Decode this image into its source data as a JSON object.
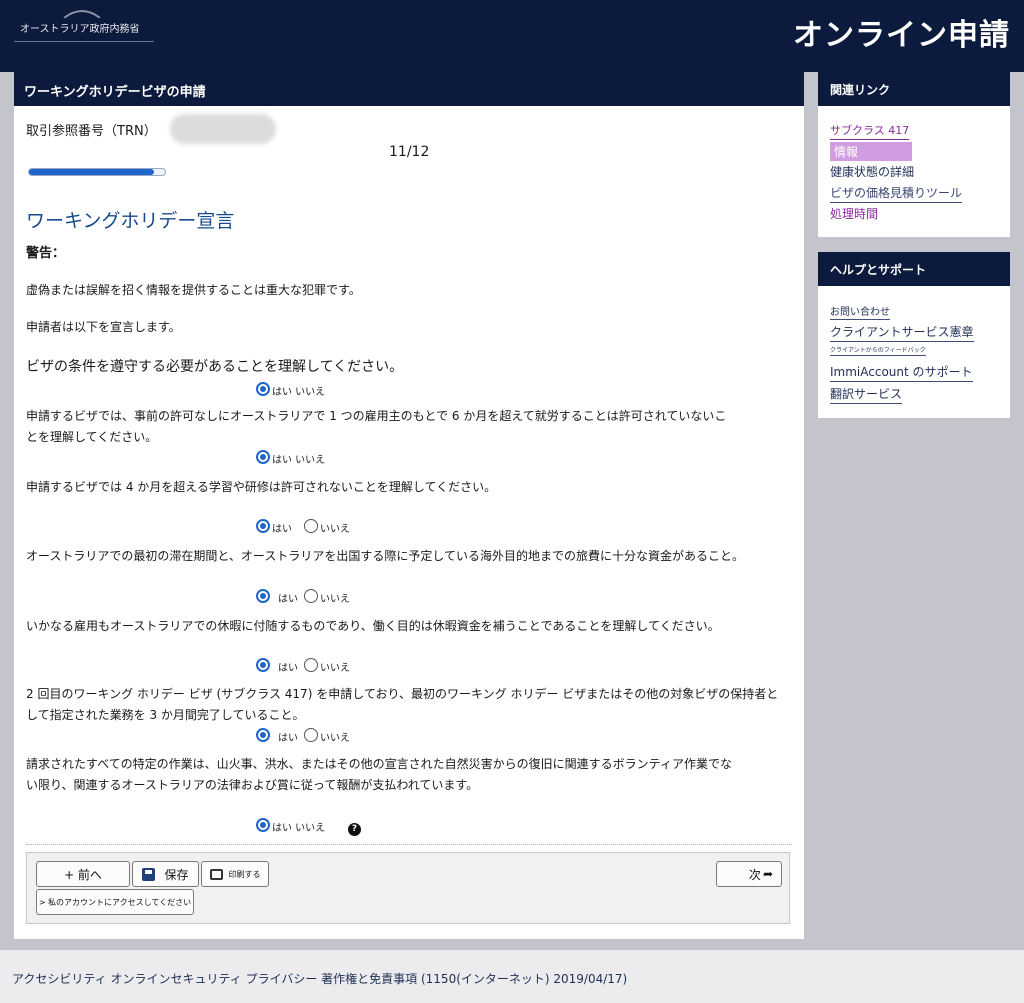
{
  "header": {
    "agency_name": "オーストラリア政府内務省",
    "site_title": "オンライン申請"
  },
  "main": {
    "panel_title": "ワーキングホリデービザの申請",
    "trn_label": "取引参照番号（TRN）",
    "page_counter": "11/12",
    "progress": 0.92,
    "section_title": "ワーキングホリデー宣言",
    "warning_label": "警告：",
    "warning_text": "虚偽または誤解を招く情報を提供することは重大な犯罪です。",
    "declare_intro": "申請者は以下を宣言します。",
    "questions": [
      {
        "text": "ビザの条件を遵守する必要があることを理解してください。",
        "answer_label": "はい いいえ"
      },
      {
        "text": "申請するビザでは、事前の許可なしにオーストラリアで 1 つの雇用主のもとで 6 か月を超えて就労することは許可されていないことを理解してください。",
        "answer_label": "はい いいえ"
      },
      {
        "text": "申請するビザでは 4 か月を超える学習や研修は許可されないことを理解してください。",
        "yes_label": "はい",
        "no_label": "いいえ"
      },
      {
        "text": "オーストラリアでの最初の滞在期間と、オーストラリアを出国する際に予定している海外目的地までの旅費に十分な資金があること。",
        "yes_label": "はい",
        "no_label": "いいえ"
      },
      {
        "text": "いかなる雇用もオーストラリアでの休暇に付随するものであり、働く目的は休暇資金を補うことであることを理解してください。",
        "yes_label": "はい",
        "no_label": "いいえ"
      },
      {
        "text": "2 回目のワーキング ホリデー ビザ (サブクラス 417) を申請しており、最初のワーキング ホリデー ビザまたはその他の対象ビザの保持者として指定された業務を 3 か月間完了していること。",
        "yes_label": "はい",
        "no_label": "いいえ"
      },
      {
        "text": "請求されたすべての特定の作業は、山火事、洪水、またはその他の宣言された自然災害からの復旧に関連するボランティア作業でない限り、関連するオーストラリアの法律および賞に従って報酬が支払われています。",
        "answer_label": "はい いいえ"
      }
    ],
    "buttons": {
      "previous": "+ 前へ",
      "save": "保存",
      "print": "印刷する",
      "next": "次",
      "account": "> 私のアカウントにアクセスしてください"
    }
  },
  "sidebar": {
    "related": {
      "title": "関連リンク",
      "links": [
        "サブクラス 417",
        "情報",
        "健康状態の詳細",
        "ビザの価格見積りツール",
        "処理時間"
      ]
    },
    "help": {
      "title": "ヘルプとサポート",
      "links": [
        "お問い合わせ",
        "クライアントサービス憲章",
        "クライアントからのフィードバック",
        "ImmiAccount のサポート",
        "翻訳サービス"
      ]
    }
  },
  "footer": {
    "text": "アクセシビリティ オンラインセキュリティ プライバシー 著作権と免責事項 (1150(インターネット) 2019/04/17)"
  },
  "colors": {
    "navy": "#0c1b3d",
    "radio_blue": "#1e66c9",
    "title_blue": "#174a8c",
    "link_purple": "#8a2a9c",
    "highlight": "#d19de0"
  }
}
